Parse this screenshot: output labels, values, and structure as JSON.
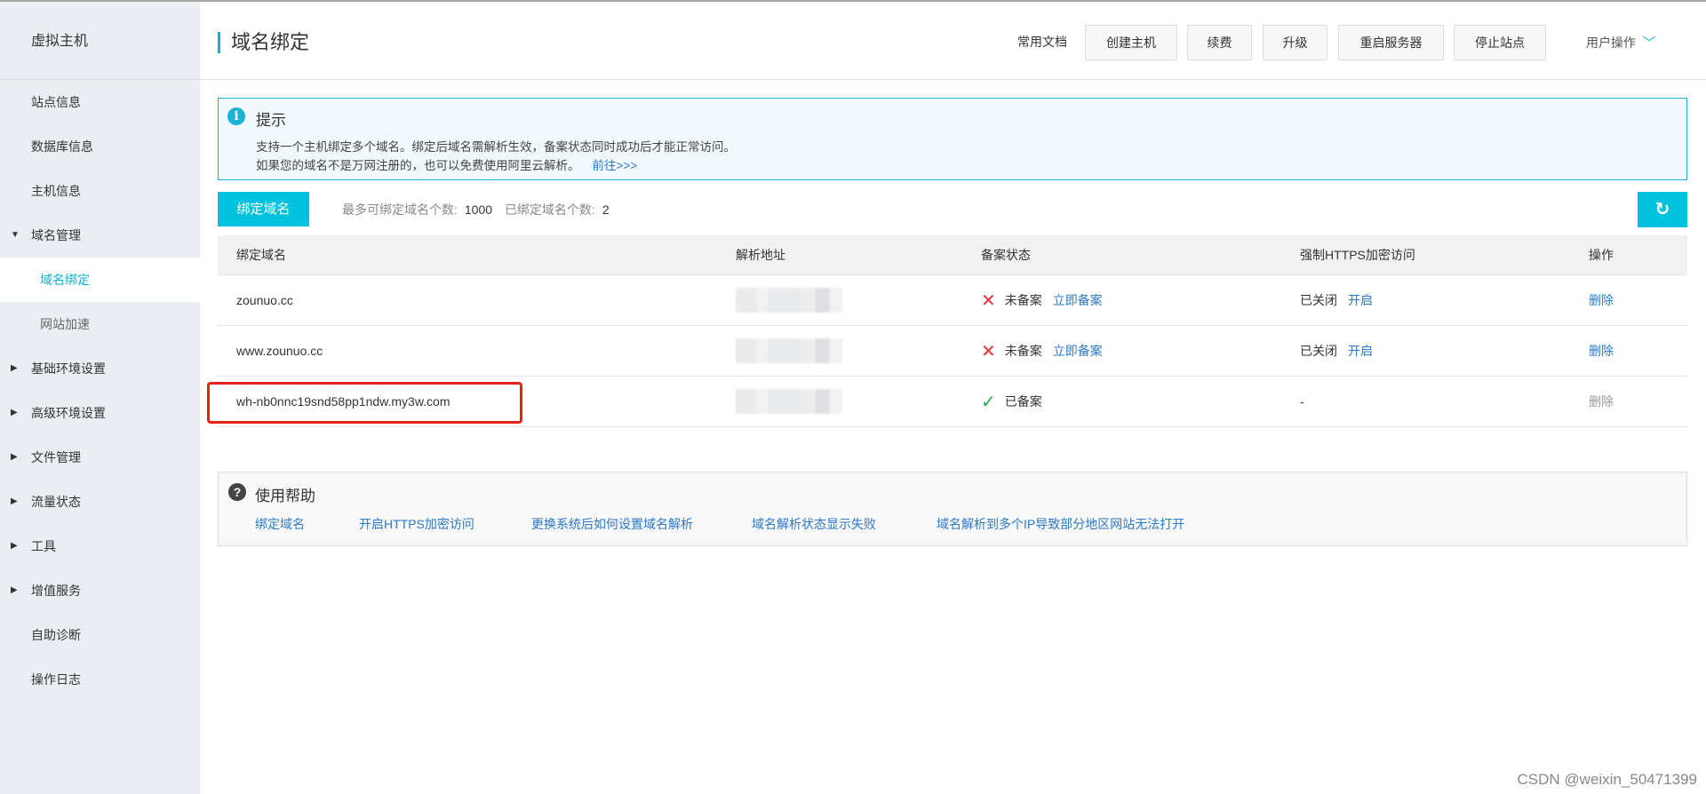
{
  "sidebar": {
    "title": "虚拟主机",
    "items": [
      {
        "label": "站点信息"
      },
      {
        "label": "数据库信息"
      },
      {
        "label": "主机信息"
      },
      {
        "label": "域名管理"
      },
      {
        "label": "域名绑定"
      },
      {
        "label": "网站加速"
      },
      {
        "label": "基础环境设置"
      },
      {
        "label": "高级环境设置"
      },
      {
        "label": "文件管理"
      },
      {
        "label": "流量状态"
      },
      {
        "label": "工具"
      },
      {
        "label": "增值服务"
      },
      {
        "label": "自助诊断"
      },
      {
        "label": "操作日志"
      }
    ]
  },
  "header": {
    "title": "域名绑定",
    "docs": "常用文档",
    "buttons": [
      "创建主机",
      "续费",
      "升级",
      "重启服务器",
      "停止站点"
    ],
    "user_menu": "用户操作"
  },
  "tip": {
    "title": "提示",
    "line1": "支持一个主机绑定多个域名。绑定后域名需解析生效，备案状态同时成功后才能正常访问。",
    "line2": "如果您的域名不是万网注册的，也可以免费使用阿里云解析。",
    "link": "前往>>>"
  },
  "toolbar": {
    "bind_button": "绑定域名",
    "max_label": "最多可绑定域名个数:",
    "max_value": "1000",
    "bound_label": "已绑定域名个数:",
    "bound_value": "2"
  },
  "table": {
    "headers": [
      "绑定域名",
      "解析地址",
      "备案状态",
      "强制HTTPS加密访问",
      "操作"
    ],
    "rows": [
      {
        "domain": "zounuo.cc",
        "icp": "未备案",
        "icp_action": "立即备案",
        "https": "已关闭",
        "https_action": "开启",
        "op": "删除"
      },
      {
        "domain": "www.zounuo.cc",
        "icp": "未备案",
        "icp_action": "立即备案",
        "https": "已关闭",
        "https_action": "开启",
        "op": "删除"
      },
      {
        "domain": "wh-nb0nnc19snd58pp1ndw.my3w.com",
        "icp": "已备案",
        "https": "-",
        "op": "删除"
      }
    ]
  },
  "help": {
    "title": "使用帮助",
    "links": [
      "绑定域名",
      "开启HTTPS加密访问",
      "更换系统后如何设置域名解析",
      "域名解析状态显示失败",
      "域名解析到多个IP导致部分地区网站无法打开"
    ]
  },
  "watermark": "CSDN @weixin_50471399",
  "colors": {
    "accent": "#00c1de",
    "link": "#2b79c7",
    "error": "#e8343a",
    "success": "#2da44e",
    "highlight": "#e8201a"
  }
}
